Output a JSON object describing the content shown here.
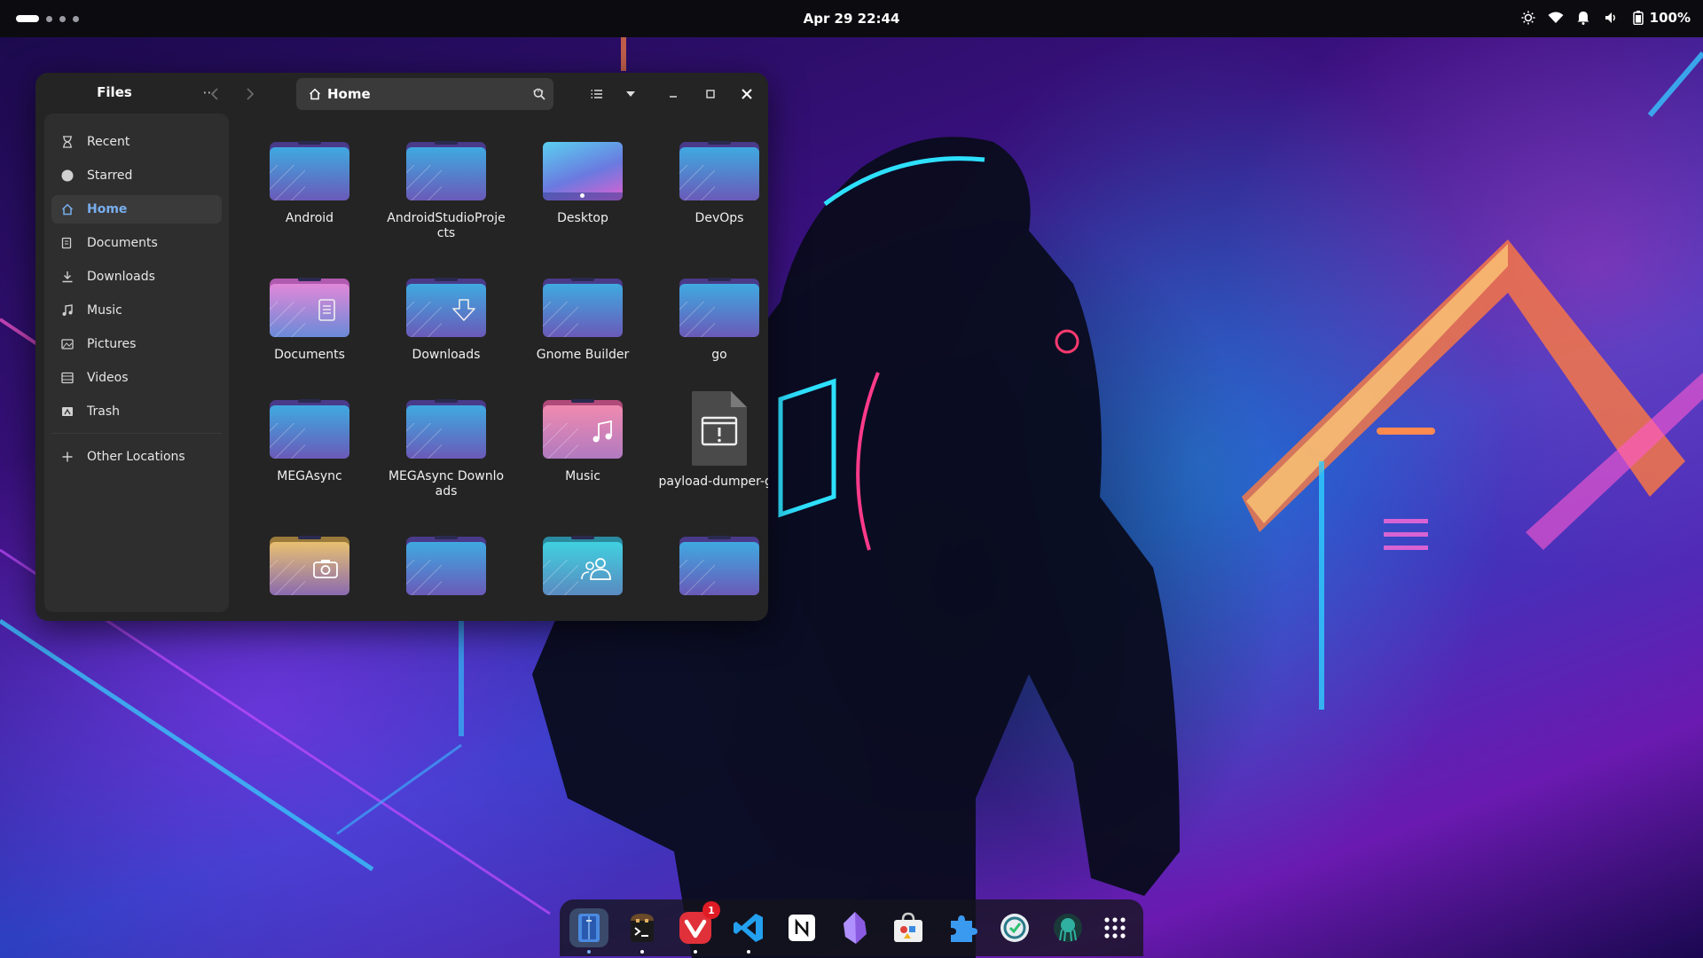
{
  "topbar": {
    "clock": "Apr 29  22:44",
    "battery": "100%",
    "tray_icons": [
      "brightness-icon",
      "wifi-icon",
      "notification-bell-icon",
      "volume-icon",
      "battery-icon"
    ]
  },
  "window": {
    "sidebar_title": "Files",
    "sidebar_menu": "⋯",
    "path": "Home",
    "path_more": "⋯"
  },
  "sidebar": {
    "items": [
      {
        "label": "Recent",
        "icon": "clock-icon"
      },
      {
        "label": "Starred",
        "icon": "star-icon"
      },
      {
        "label": "Home",
        "icon": "home-icon",
        "active": true
      },
      {
        "label": "Documents",
        "icon": "document-icon"
      },
      {
        "label": "Downloads",
        "icon": "download-icon"
      },
      {
        "label": "Music",
        "icon": "music-icon"
      },
      {
        "label": "Pictures",
        "icon": "picture-icon"
      },
      {
        "label": "Videos",
        "icon": "video-icon"
      },
      {
        "label": "Trash",
        "icon": "trash-icon"
      }
    ],
    "other_locations": "Other Locations"
  },
  "files": [
    {
      "name": "Android",
      "kind": "folder"
    },
    {
      "name": "AndroidStudioProjects",
      "kind": "folder"
    },
    {
      "name": "Desktop",
      "kind": "desktop"
    },
    {
      "name": "DevOps",
      "kind": "folder"
    },
    {
      "name": "Documents",
      "kind": "documents"
    },
    {
      "name": "Downloads",
      "kind": "downloads"
    },
    {
      "name": "Gnome Builder",
      "kind": "folder"
    },
    {
      "name": "go",
      "kind": "folder"
    },
    {
      "name": "MEGAsync",
      "kind": "folder"
    },
    {
      "name": "MEGAsync Downloads",
      "kind": "folder"
    },
    {
      "name": "Music",
      "kind": "music"
    },
    {
      "name": "payload-dumper-go",
      "kind": "executable"
    },
    {
      "name": "",
      "kind": "pictures"
    },
    {
      "name": "",
      "kind": "folder"
    },
    {
      "name": "",
      "kind": "public"
    },
    {
      "name": "",
      "kind": "folder"
    }
  ],
  "dock": {
    "apps": [
      "files-icon",
      "terminal-icon",
      "vivaldi-icon",
      "vscode-icon",
      "notion-icon",
      "obsidian-icon",
      "software-store-icon",
      "extensions-icon",
      "sync-app-icon",
      "gitkraken-icon",
      "app-grid-icon"
    ],
    "vivaldi_badge": "1"
  },
  "colors": {
    "accent": "#78aeed",
    "folder_top": "#3fa9e0",
    "folder_bottom": "#6a5ab8"
  }
}
